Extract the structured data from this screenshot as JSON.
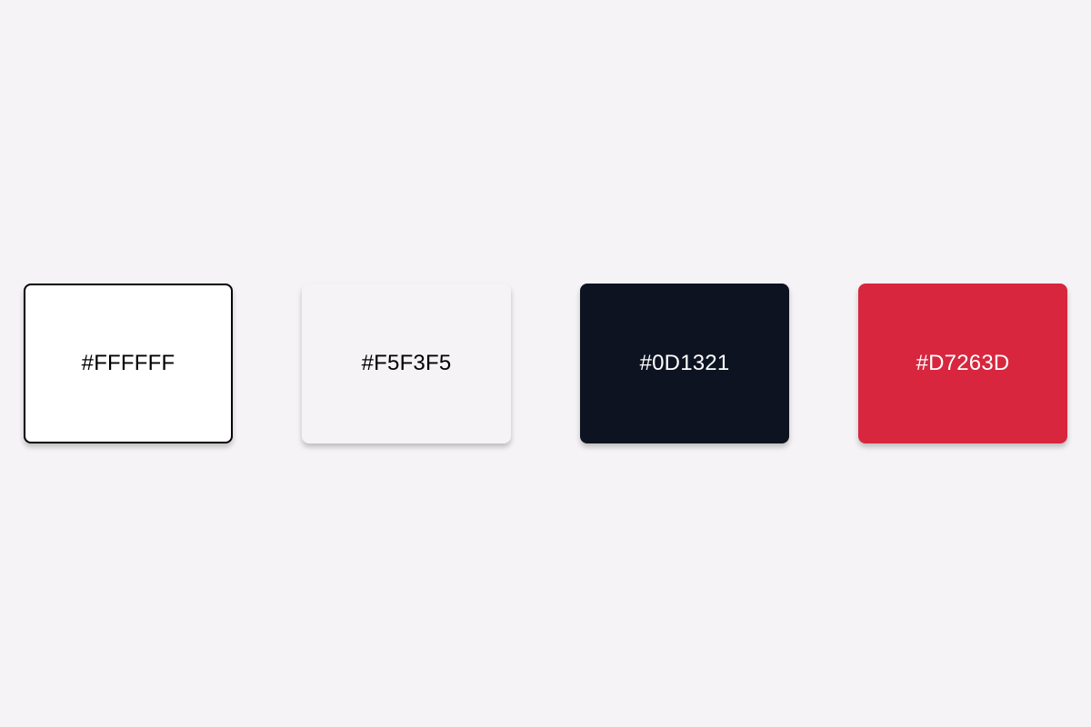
{
  "background": "#F5F3F5",
  "swatches": [
    {
      "label": "#FFFFFF",
      "color": "#FFFFFF",
      "text_color": "#000000"
    },
    {
      "label": "#F5F3F5",
      "color": "#F5F3F5",
      "text_color": "#000000"
    },
    {
      "label": "#0D1321",
      "color": "#0D1321",
      "text_color": "#FFFFFF"
    },
    {
      "label": "#D7263D",
      "color": "#D7263D",
      "text_color": "#FFFFFF"
    }
  ]
}
